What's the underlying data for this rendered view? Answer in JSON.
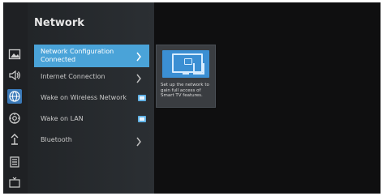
{
  "header": {
    "title": "Network"
  },
  "sidebar": {
    "icons": [
      {
        "name": "picture-icon"
      },
      {
        "name": "sound-icon"
      },
      {
        "name": "network-icon"
      },
      {
        "name": "system-icon"
      },
      {
        "name": "support-icon"
      },
      {
        "name": "guide-icon"
      },
      {
        "name": "tv-icon"
      }
    ]
  },
  "menu": {
    "items": [
      {
        "label": "Network Configuration",
        "sublabel": "Connected",
        "type": "nav",
        "selected": true
      },
      {
        "label": "Internet Connection",
        "type": "nav"
      },
      {
        "label": "Wake on Wireless Network",
        "type": "toggle",
        "value": true
      },
      {
        "label": "Wake on LAN",
        "type": "toggle",
        "value": true
      },
      {
        "label": "Bluetooth",
        "type": "nav"
      }
    ]
  },
  "info": {
    "text": "Set up the network to gain full access of Smart TV features."
  },
  "colors": {
    "accent": "#4aa3d8",
    "panel": "#2b2f33",
    "background": "#0f0f10"
  }
}
